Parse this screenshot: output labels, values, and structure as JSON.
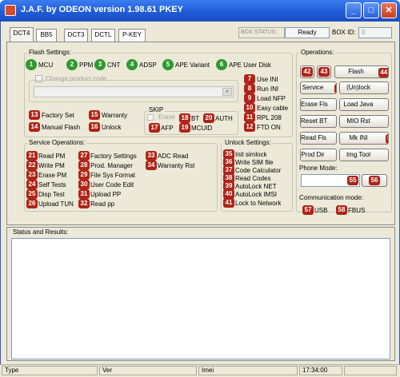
{
  "window": {
    "title": "J.A.F. by ODEON version 1.98.61 PKEY",
    "min_glyph": "_",
    "max_glyph": "□",
    "close_glyph": "✕"
  },
  "tabs": [
    "DCT4",
    "BB5",
    "DCT3",
    "DCTL",
    "P-KEY"
  ],
  "box": {
    "status_label": "BOX STATUS:",
    "status_value": "Ready",
    "id_label": "BOX ID:",
    "id_value": "0"
  },
  "flash_settings": {
    "title": "Flash Settings:",
    "items": [
      {
        "num": "1",
        "label": "MCU"
      },
      {
        "num": "2",
        "label": "PPM"
      },
      {
        "num": "3",
        "label": "CNT"
      },
      {
        "num": "4",
        "label": "ADSP"
      },
      {
        "num": "5",
        "label": "APE Variant"
      },
      {
        "num": "6",
        "label": "APE User Disk"
      }
    ],
    "change_product": "Change product code",
    "right_options": [
      {
        "num": "7",
        "label": "Use INI"
      },
      {
        "num": "8",
        "label": "Run INI"
      },
      {
        "num": "9",
        "label": "Load NFP"
      },
      {
        "num": "10",
        "label": "Easy cable"
      },
      {
        "num": "11",
        "label": "RPL 208"
      },
      {
        "num": "12",
        "label": "FTD ON"
      }
    ],
    "left_options": [
      {
        "num": "13",
        "label": "Factory Set"
      },
      {
        "num": "14",
        "label": "Manual Flash"
      },
      {
        "num": "15",
        "label": "Warranty"
      },
      {
        "num": "16",
        "label": "Unlock"
      }
    ],
    "skip": {
      "title": "SKIP",
      "items": [
        {
          "num": "",
          "label": "Erase"
        },
        {
          "num": "18",
          "label": "BT"
        },
        {
          "num": "20",
          "label": "AUTH"
        },
        {
          "num": "17",
          "label": "AFP"
        },
        {
          "num": "19",
          "label": "MCUID"
        }
      ]
    }
  },
  "operations": {
    "title": "Operations:",
    "buttons": [
      {
        "num": "42",
        "label": ""
      },
      {
        "num": "43",
        "label": ""
      },
      {
        "num": "44",
        "label": "Flash"
      },
      {
        "num": "45",
        "label": "Service"
      },
      {
        "num": "46",
        "label": "(Un)lock"
      },
      {
        "num": "47",
        "label": "Erase Fls"
      },
      {
        "num": "48",
        "label": "Load Java"
      },
      {
        "num": "49",
        "label": "Reset BT"
      },
      {
        "num": "50",
        "label": "MIO Rst"
      },
      {
        "num": "51",
        "label": "Read Fls"
      },
      {
        "num": "52",
        "label": "Mk INI"
      },
      {
        "num": "53",
        "label": "Prod Dir"
      },
      {
        "num": "54",
        "label": "Img Tool"
      }
    ],
    "phone_mode_label": "Phone Mode:",
    "phone_mode_nums": [
      "55",
      "56"
    ],
    "comm_mode_label": "Communication mode:",
    "comm_modes": [
      {
        "num": "57",
        "label": "USB"
      },
      {
        "num": "58",
        "label": "FBUS"
      }
    ]
  },
  "service_operations": {
    "title": "Service Operations:",
    "col1": [
      {
        "num": "21",
        "label": "Read PM"
      },
      {
        "num": "22",
        "label": "Write PM"
      },
      {
        "num": "23",
        "label": "Erase PM"
      },
      {
        "num": "24",
        "label": "Self Tests"
      },
      {
        "num": "25",
        "label": "Disp Test"
      },
      {
        "num": "26",
        "label": "Upload TUN"
      }
    ],
    "col2": [
      {
        "num": "27",
        "label": "Factory Settings"
      },
      {
        "num": "28",
        "label": "Prod. Manager"
      },
      {
        "num": "29",
        "label": "File Sys Format"
      },
      {
        "num": "30",
        "label": "User Code Edit"
      },
      {
        "num": "31",
        "label": "Upload PP"
      },
      {
        "num": "32",
        "label": "Read pp"
      }
    ],
    "col3": [
      {
        "num": "33",
        "label": "ADC Read"
      },
      {
        "num": "34",
        "label": "Warranty Rst"
      }
    ]
  },
  "unlock_settings": {
    "title": "Unlock Settings:",
    "items": [
      {
        "num": "35",
        "label": "Init simlock"
      },
      {
        "num": "36",
        "label": "Write SIM file"
      },
      {
        "num": "37",
        "label": "Code Calculator"
      },
      {
        "num": "38",
        "label": "Read Codes"
      },
      {
        "num": "39",
        "label": "AutoLock NET"
      },
      {
        "num": "40",
        "label": "AutoLock IMSI"
      },
      {
        "num": "41",
        "label": "Lock to Network"
      }
    ]
  },
  "status": {
    "title": "Status and Results:"
  },
  "statusbar": {
    "type": "Type",
    "ver": "Ver",
    "imei": "Imei",
    "time": "17:34:00"
  }
}
